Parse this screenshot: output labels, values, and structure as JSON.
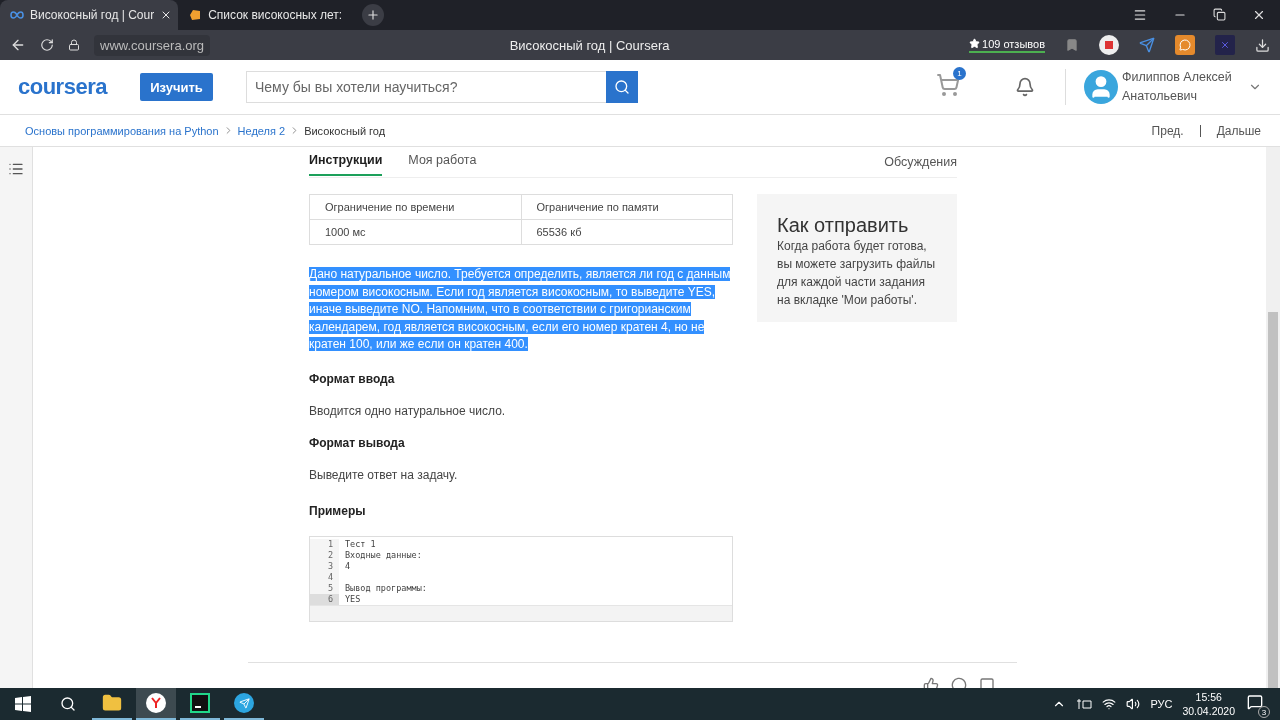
{
  "browser": {
    "tabs": [
      {
        "title": "Високосный год | Cour",
        "selected": true
      },
      {
        "title": "Список високосных лет:",
        "selected": false
      }
    ],
    "address": "www.coursera.org",
    "page_title": "Високосный год | Coursera",
    "reviews": "109 отзывов"
  },
  "header": {
    "logo": "coursera",
    "explore_button": "Изучить",
    "search": {
      "placeholder": "Чему бы вы хотели научиться?"
    },
    "cart_count": "1",
    "user_name": [
      "Филиппов Алексей",
      "Анатольевич"
    ]
  },
  "breadcrumbs": [
    {
      "label": "Основы программирования на Python",
      "link": true
    },
    {
      "label": "Неделя 2",
      "link": true
    },
    {
      "label": "Високосный год",
      "link": false
    }
  ],
  "nav": {
    "prev": "Пред.",
    "next": "Дальше"
  },
  "content_tabs": [
    {
      "label": "Инструкции",
      "selected": true
    },
    {
      "label": "Моя работа",
      "selected": false
    }
  ],
  "discussions": "Обсуждения",
  "limits": {
    "columns": [
      "Ограничение по времени",
      "Ограничение по памяти"
    ],
    "row": [
      "1000 мс",
      "65536 кб"
    ]
  },
  "statement": {
    "text": "Дано натуральное число. Требуется определить, является ли год с данным номером високосным. Если год является високосным, то выведите YES, иначе выведите NO. Напомним, что в соответствии с григорианским календарем, год является високосным, если его номер кратен 4, но не кратен 100, или же если он кратен 400.",
    "highlighted": true
  },
  "sections": [
    {
      "heading": "Формат ввода",
      "text": "Вводится одно натуральное число."
    },
    {
      "heading": "Формат вывода",
      "text": "Выведите ответ на задачу."
    }
  ],
  "examples": {
    "heading": "Примеры",
    "lines": [
      {
        "number": "1",
        "text": "Тест 1",
        "current": false
      },
      {
        "number": "2",
        "text": "Входные данные:",
        "current": false
      },
      {
        "number": "3",
        "text": "4",
        "current": false
      },
      {
        "number": "4",
        "current": false
      },
      {
        "number": "5",
        "text": "Вывод программы:",
        "current": false
      },
      {
        "number": "6",
        "text": "YES",
        "current": true
      }
    ]
  },
  "how_to_submit": {
    "title": "Как отправить",
    "text": "Когда работа будет готова, вы можете загрузить файлы для каждой части задания на вкладке 'Мои работы'."
  },
  "taskbar": {
    "apps": [
      {
        "kind": "explorer",
        "active": false
      },
      {
        "kind": "browser",
        "active": true
      },
      {
        "kind": "ide",
        "active": false
      },
      {
        "kind": "messenger",
        "active": false
      }
    ],
    "language": "РУС",
    "time": "15:56",
    "date": "30.04.2020",
    "notifications": "3"
  }
}
